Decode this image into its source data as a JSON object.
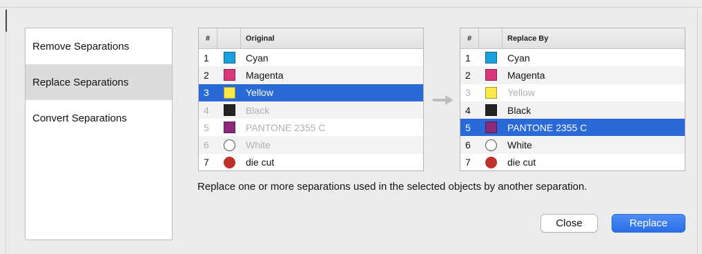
{
  "sidebar": {
    "items": [
      {
        "label": "Remove Separations",
        "active": false
      },
      {
        "label": "Replace Separations",
        "active": true
      },
      {
        "label": "Convert Separations",
        "active": false
      }
    ]
  },
  "original_table": {
    "col_num": "#",
    "col_name": "Original",
    "rows": [
      {
        "num": "1",
        "name": "Cyan",
        "color": "#1aa0dc",
        "shape": "square",
        "state": "normal"
      },
      {
        "num": "2",
        "name": "Magenta",
        "color": "#d9357a",
        "shape": "square",
        "state": "normal"
      },
      {
        "num": "3",
        "name": "Yellow",
        "color": "#fbe94a",
        "shape": "square",
        "state": "selected"
      },
      {
        "num": "4",
        "name": "Black",
        "color": "#232323",
        "shape": "square",
        "state": "disabled"
      },
      {
        "num": "5",
        "name": "PANTONE 2355 C",
        "color": "#8b2a7a",
        "shape": "square",
        "state": "disabled"
      },
      {
        "num": "6",
        "name": "White",
        "color": "#ffffff",
        "shape": "circle",
        "state": "disabled"
      },
      {
        "num": "7",
        "name": "die cut",
        "color": "#c0302a",
        "shape": "circle",
        "state": "normal"
      }
    ]
  },
  "replace_table": {
    "col_num": "#",
    "col_name": "Replace By",
    "rows": [
      {
        "num": "1",
        "name": "Cyan",
        "color": "#1aa0dc",
        "shape": "square",
        "state": "normal"
      },
      {
        "num": "2",
        "name": "Magenta",
        "color": "#d9357a",
        "shape": "square",
        "state": "normal"
      },
      {
        "num": "3",
        "name": "Yellow",
        "color": "#fbe94a",
        "shape": "square",
        "state": "disabled"
      },
      {
        "num": "4",
        "name": "Black",
        "color": "#232323",
        "shape": "square",
        "state": "normal"
      },
      {
        "num": "5",
        "name": "PANTONE 2355 C",
        "color": "#8b2a7a",
        "shape": "square",
        "state": "selected"
      },
      {
        "num": "6",
        "name": "White",
        "color": "#ffffff",
        "shape": "circle",
        "state": "normal"
      },
      {
        "num": "7",
        "name": "die cut",
        "color": "#c0302a",
        "shape": "circle",
        "state": "normal"
      }
    ]
  },
  "arrow_icon": "right-arrow-icon",
  "description": "Replace one or more separations used in the selected objects by another separation.",
  "buttons": {
    "close_label": "Close",
    "replace_label": "Replace"
  },
  "colors": {
    "selection": "#2a6ad8",
    "primary_button": "#2b6fe6"
  }
}
